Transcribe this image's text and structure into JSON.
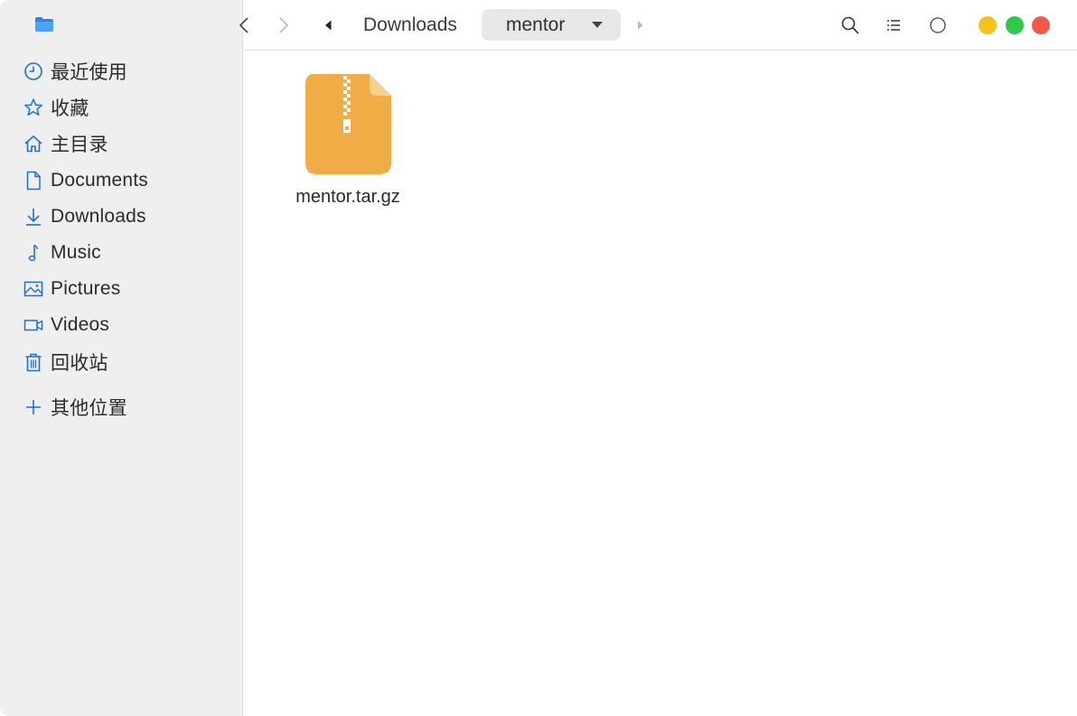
{
  "sidebar": {
    "app_icon": "folder-icon",
    "items": [
      {
        "label": "最近使用",
        "icon": "clock-icon"
      },
      {
        "label": "收藏",
        "icon": "star-icon"
      },
      {
        "label": "主目录",
        "icon": "home-icon"
      },
      {
        "label": "Documents",
        "icon": "document-icon"
      },
      {
        "label": "Downloads",
        "icon": "download-icon"
      },
      {
        "label": "Music",
        "icon": "music-note-icon"
      },
      {
        "label": "Pictures",
        "icon": "picture-icon"
      },
      {
        "label": "Videos",
        "icon": "video-icon"
      },
      {
        "label": "回收站",
        "icon": "trash-icon"
      }
    ],
    "other_places": {
      "label": "其他位置",
      "icon": "plus-icon"
    }
  },
  "toolbar": {
    "breadcrumb": {
      "parent": "Downloads",
      "current": "mentor"
    },
    "icons": [
      "back-icon",
      "forward-icon",
      "breadcrumb-left-icon",
      "breadcrumb-right-icon",
      "search-icon",
      "list-view-icon",
      "circle-icon"
    ]
  },
  "window_controls": {
    "minimize_color": "#f5c21b",
    "maximize_color": "#2fc84a",
    "close_color": "#f4574b"
  },
  "files": [
    {
      "name": "mentor.tar.gz",
      "icon": "archive-icon",
      "color": "#f1ad45"
    }
  ],
  "colors": {
    "accent": "#1f6fd6",
    "sidebar_bg": "#efefef"
  }
}
